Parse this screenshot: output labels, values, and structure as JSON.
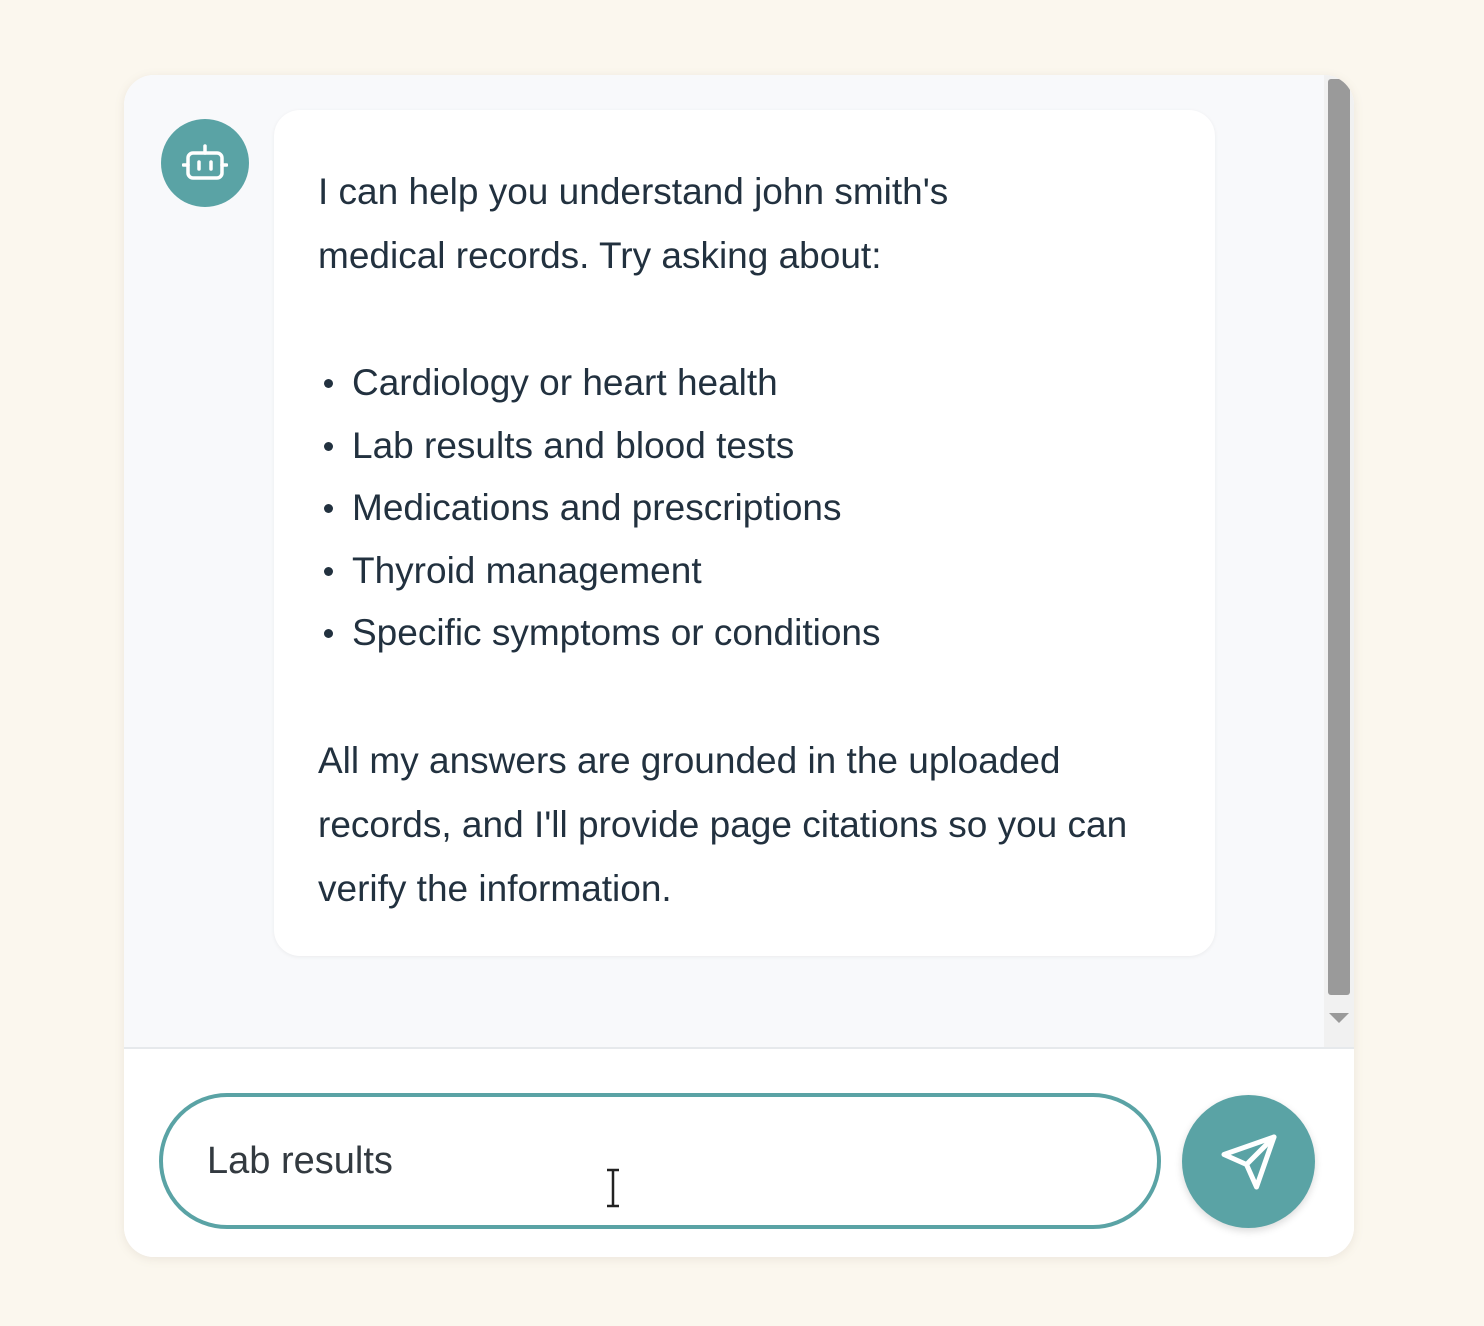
{
  "chat": {
    "assistant_message": {
      "intro": "I can help you understand john smith's medical records. Try asking about:",
      "topics": [
        "Cardiology or heart health",
        "Lab results and blood tests",
        "Medications and prescriptions",
        "Thyroid management",
        "Specific symptoms or conditions"
      ],
      "closing": "All my answers are grounded in the uploaded records, and I'll provide page citations so you can verify the information."
    },
    "avatar_icon": "robot-icon"
  },
  "composer": {
    "input_value": "Lab results",
    "send_icon": "send-icon"
  },
  "colors": {
    "accent": "#5aa3a5",
    "page_background": "#fbf7ee",
    "text": "#22313f"
  }
}
